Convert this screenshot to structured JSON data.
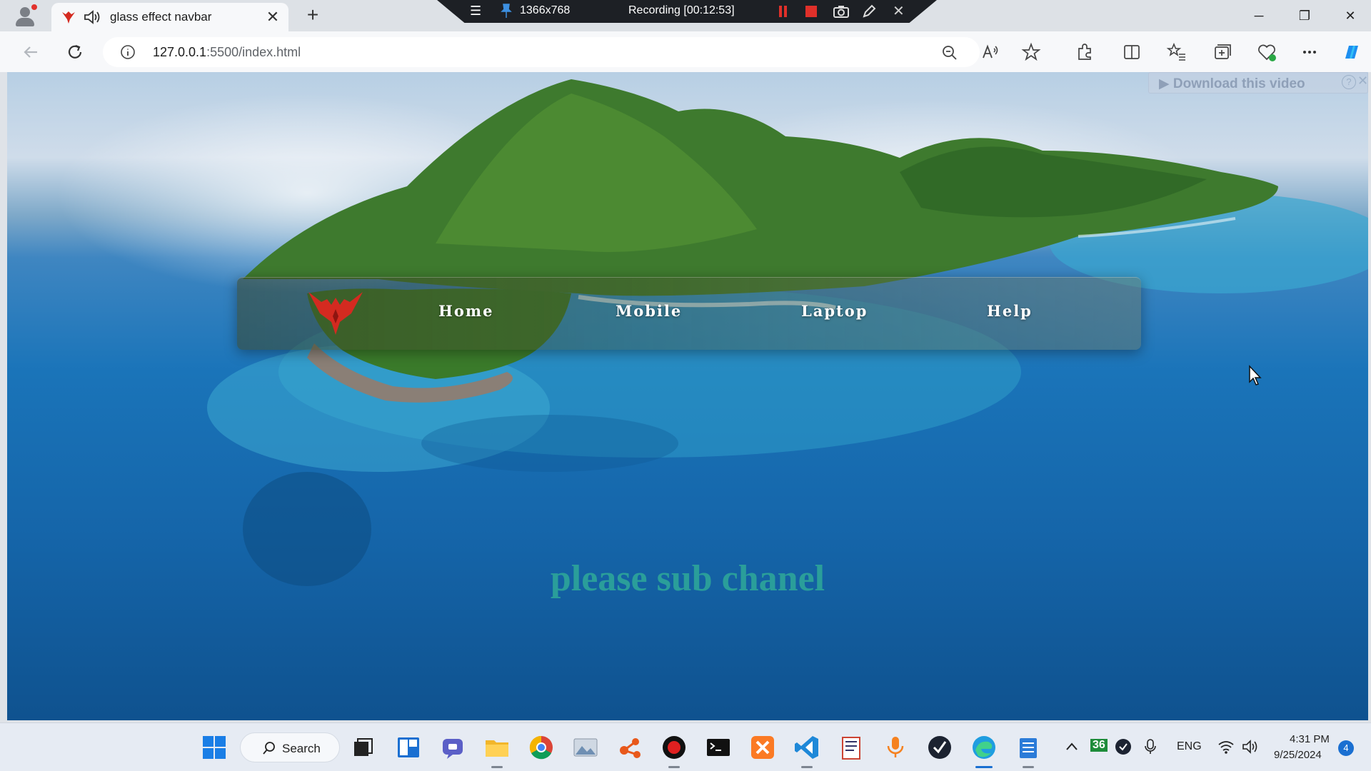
{
  "browser": {
    "tab": {
      "title": "glass effect navbar"
    },
    "address": {
      "url_host": "127.0.0.1",
      "url_rest": ":5500/index.html"
    }
  },
  "recorder": {
    "resolution": "1366x768",
    "status": "Recording [00:12:53]"
  },
  "page": {
    "download_overlay": "Download this video",
    "download_help": "?",
    "nav": {
      "links": [
        "Home",
        "Mobile",
        "Laptop",
        "Help"
      ]
    },
    "hero_text": "please sub chanel",
    "colors": {
      "hero_text": "#2a9e9a",
      "logo": "#d42a20"
    }
  },
  "taskbar": {
    "search_label": "Search",
    "badge_count": "36",
    "language": "ENG",
    "time": "4:31 PM",
    "date": "9/25/2024",
    "notification_count": "4"
  }
}
